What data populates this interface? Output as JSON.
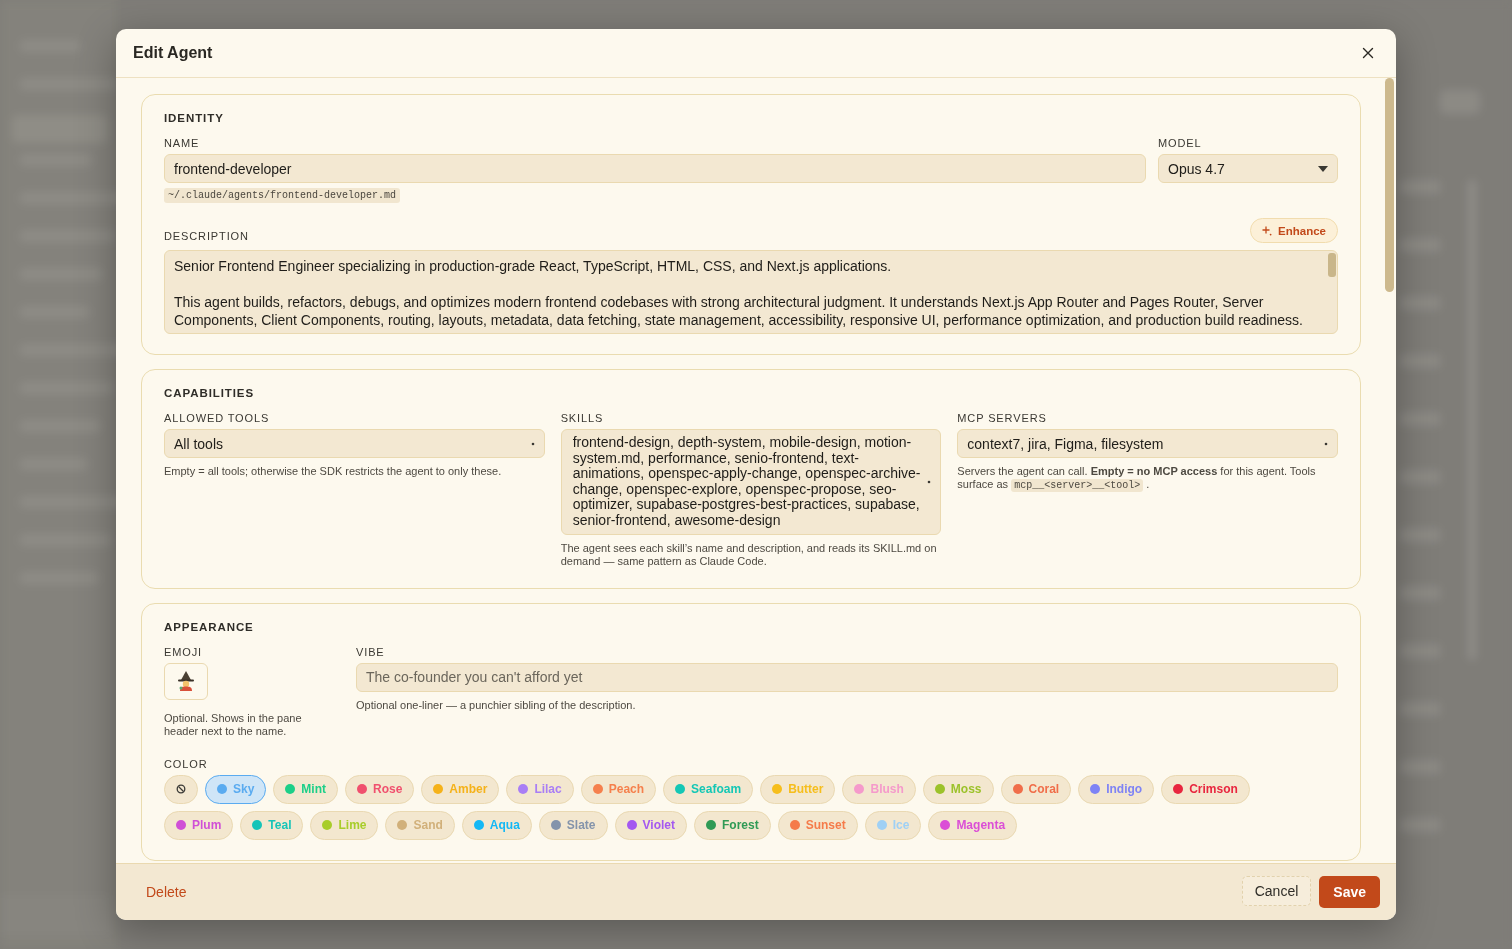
{
  "dialog": {
    "title": "Edit Agent"
  },
  "identity": {
    "heading": "IDENTITY",
    "name_label": "NAME",
    "name_value": "frontend-developer",
    "path": "~/.claude/agents/frontend-developer.md",
    "model_label": "MODEL",
    "model_value": "Opus 4.7",
    "description_label": "DESCRIPTION",
    "enhance_button": "Enhance",
    "description_paragraphs": [
      "Senior Frontend Engineer specializing in production-grade React, TypeScript, HTML, CSS, and Next.js applications.",
      "This agent builds, refactors, debugs, and optimizes modern frontend codebases with strong architectural judgment. It understands Next.js App Router and Pages Router, Server Components, Client Components, routing, layouts, metadata, data fetching, state management, accessibility, responsive UI, performance optimization, and production build readiness."
    ]
  },
  "capabilities": {
    "heading": "CAPABILITIES",
    "allowed_tools": {
      "label": "ALLOWED TOOLS",
      "value": "All tools",
      "hint": "Empty = all tools; otherwise the SDK restricts the agent to only these."
    },
    "skills": {
      "label": "SKILLS",
      "value": "frontend-design, depth-system, mobile-design, motion-system.md, performance, senio-frontend, text-animations, openspec-apply-change, openspec-archive-change, openspec-explore, openspec-propose, seo-optimizer, supabase-postgres-best-practices, supabase, senior-frontend, awesome-design",
      "hint": "The agent sees each skill’s name and description, and reads its SKILL.md on demand — same pattern as Claude Code."
    },
    "mcp_servers": {
      "label": "MCP SERVERS",
      "value": "context7, jira, Figma, filesystem",
      "hint": "Servers the agent can call. **Empty = no MCP access** for this agent. Tools surface as ",
      "hint_code": "mcp__<server>__<tool>",
      "hint_end": "."
    }
  },
  "appearance": {
    "heading": "APPEARANCE",
    "emoji_label": "EMOJI",
    "emoji_hint": "Optional. Shows in the pane header next to the name.",
    "vibe_label": "VIBE",
    "vibe_placeholder": "The co-founder you can't afford yet",
    "vibe_hint": "Optional one-liner — a punchier sibling of the description.",
    "color_label": "COLOR",
    "colors": [
      {
        "kind": "none",
        "selected": false
      },
      {
        "kind": "color",
        "label": "Sky",
        "color": "#5aabf0",
        "selected": true
      },
      {
        "kind": "color",
        "label": "Mint",
        "color": "#1ccf88",
        "selected": false
      },
      {
        "kind": "color",
        "label": "Rose",
        "color": "#f0506e",
        "selected": false
      },
      {
        "kind": "color",
        "label": "Amber",
        "color": "#f5b21a",
        "selected": false
      },
      {
        "kind": "color",
        "label": "Lilac",
        "color": "#a97ef5",
        "selected": false
      },
      {
        "kind": "color",
        "label": "Peach",
        "color": "#f5804d",
        "selected": false
      },
      {
        "kind": "color",
        "label": "Seafoam",
        "color": "#14c7b5",
        "selected": false
      },
      {
        "kind": "color",
        "label": "Butter",
        "color": "#f6be1c",
        "selected": false
      },
      {
        "kind": "color",
        "label": "Blush",
        "color": "#f59acb",
        "selected": false
      },
      {
        "kind": "color",
        "label": "Moss",
        "color": "#9cc22a",
        "selected": false
      },
      {
        "kind": "color",
        "label": "Coral",
        "color": "#f06e4a",
        "selected": false
      },
      {
        "kind": "color",
        "label": "Indigo",
        "color": "#7e83f5",
        "selected": false
      },
      {
        "kind": "color",
        "label": "Crimson",
        "color": "#e8263f",
        "selected": false
      },
      {
        "kind": "color",
        "label": "Plum",
        "color": "#d04fd6",
        "selected": false
      },
      {
        "kind": "color",
        "label": "Teal",
        "color": "#16c4b8",
        "selected": false
      },
      {
        "kind": "color",
        "label": "Lime",
        "color": "#a8cd2a",
        "selected": false
      },
      {
        "kind": "color",
        "label": "Sand",
        "color": "#d1b07a",
        "selected": false
      },
      {
        "kind": "color",
        "label": "Aqua",
        "color": "#14b8f5",
        "selected": false
      },
      {
        "kind": "color",
        "label": "Slate",
        "color": "#8494ab",
        "selected": false
      },
      {
        "kind": "color",
        "label": "Violet",
        "color": "#a458f0",
        "selected": false
      },
      {
        "kind": "color",
        "label": "Forest",
        "color": "#2f9a55",
        "selected": false
      },
      {
        "kind": "color",
        "label": "Sunset",
        "color": "#f57b4a",
        "selected": false
      },
      {
        "kind": "color",
        "label": "Ice",
        "color": "#9fd0f5",
        "selected": false
      },
      {
        "kind": "color",
        "label": "Magenta",
        "color": "#db4fd6",
        "selected": false
      }
    ]
  },
  "footer": {
    "delete": "Delete",
    "cancel": "Cancel",
    "save": "Save"
  }
}
